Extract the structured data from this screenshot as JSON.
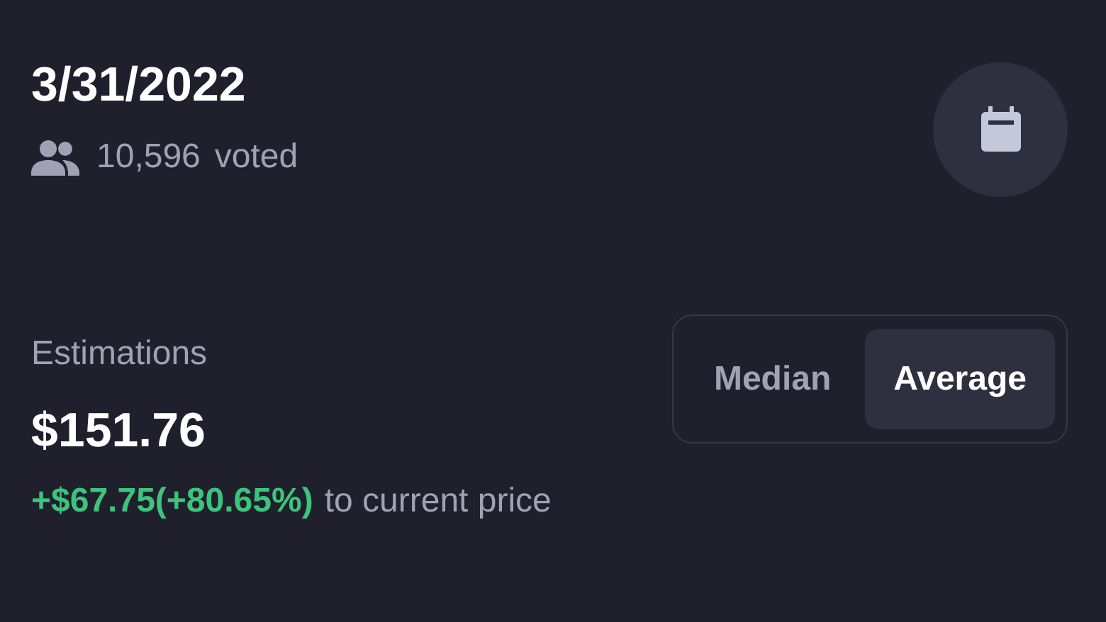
{
  "date": "3/31/2022",
  "votes": {
    "count": "10,596",
    "label": "voted"
  },
  "estimations": {
    "label": "Estimations",
    "value": "$151.76",
    "change": "+$67.75(+80.65%)",
    "suffix": "to current price"
  },
  "modes": [
    {
      "label": "Median",
      "selected": false
    },
    {
      "label": "Average",
      "selected": true
    }
  ]
}
